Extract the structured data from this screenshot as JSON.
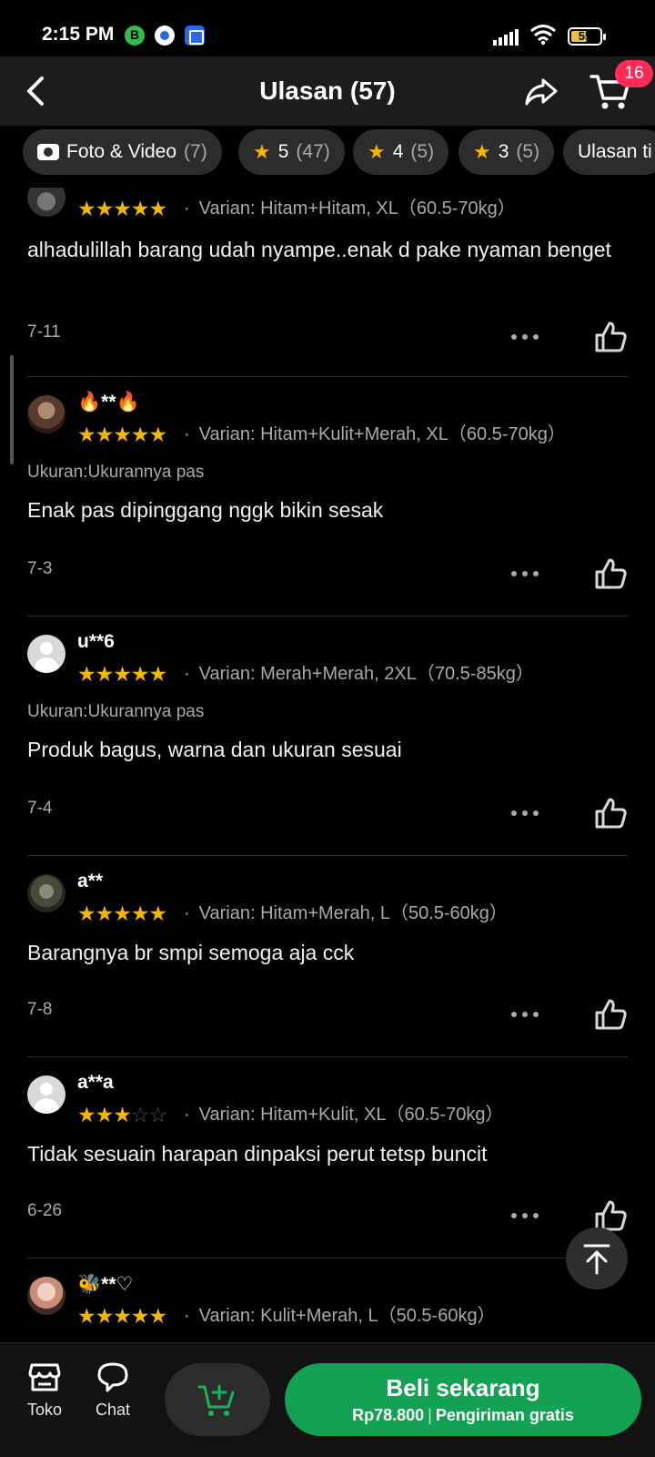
{
  "status_bar": {
    "time": "2:15 PM",
    "battery": "55",
    "battery_fraction": 0.55
  },
  "header": {
    "title": "Ulasan (57)",
    "cart_badge": "16"
  },
  "filters": [
    {
      "label": "Foto & Video",
      "count": "(7)",
      "icon": "camera-icon"
    },
    {
      "label": "5",
      "count": "(47)",
      "icon": "star-icon"
    },
    {
      "label": "4",
      "count": "(5)",
      "icon": "star-icon"
    },
    {
      "label": "3",
      "count": "(5)",
      "icon": "star-icon"
    },
    {
      "label": "Ulasan ti",
      "count": ""
    }
  ],
  "reviews": [
    {
      "user": "",
      "rating": 5,
      "variant": "Varian: Hitam+Hitam, XL（60.5-70kg）",
      "size": "",
      "text": "alhadulillah barang udah nyampe..enak d pake nyaman benget",
      "date": "7-11"
    },
    {
      "user": "🔥**🔥",
      "rating": 5,
      "variant": "Varian: Hitam+Kulit+Merah, XL（60.5-70kg）",
      "size": "Ukuran:Ukurannya pas",
      "text": "Enak pas dipinggang nggk bikin sesak",
      "date": "7-3"
    },
    {
      "user": "u**6",
      "rating": 5,
      "variant": "Varian: Merah+Merah, 2XL（70.5-85kg）",
      "size": "Ukuran:Ukurannya pas",
      "text": "Produk bagus, warna dan ukuran sesuai",
      "date": "7-4"
    },
    {
      "user": "a**",
      "rating": 5,
      "variant": "Varian: Hitam+Merah, L（50.5-60kg）",
      "size": "",
      "text": "Barangnya br smpi semoga aja cck",
      "date": "7-8"
    },
    {
      "user": "a**a",
      "rating": 3,
      "variant": "Varian: Hitam+Kulit, XL（60.5-70kg）",
      "size": "",
      "text": "Tidak sesuain harapan dinpaksi perut tetsp buncit",
      "date": "6-26"
    },
    {
      "user": "🐝**♡",
      "rating": 5,
      "variant": "Varian: Kulit+Merah, L（50.5-60kg）",
      "size": "",
      "text": "",
      "date": ""
    }
  ],
  "bottom_bar": {
    "shop_label": "Toko",
    "chat_label": "Chat",
    "buy_label": "Beli sekarang",
    "price": "Rp78.800",
    "shipping": "Pengiriman gratis"
  },
  "colors": {
    "accent_green": "#13a253",
    "star": "#f4b400",
    "badge": "#fe2c55"
  }
}
